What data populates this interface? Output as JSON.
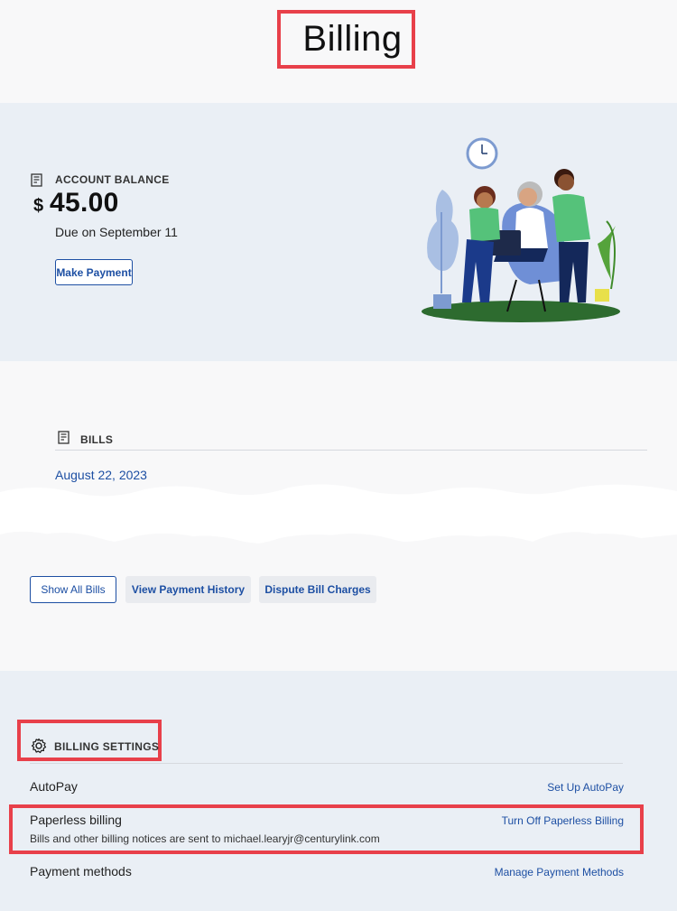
{
  "page": {
    "title": "Billing"
  },
  "balance": {
    "label": "ACCOUNT BALANCE",
    "currency": "$",
    "amount": "45.00",
    "due": "Due on September 11",
    "pay_button": "Make Payment"
  },
  "bills": {
    "label": "BILLS",
    "items": [
      "August 22, 2023"
    ],
    "buttons": {
      "show_all": "Show All Bills",
      "history": "View Payment History",
      "dispute": "Dispute Bill Charges"
    }
  },
  "settings": {
    "label": "BILLING SETTINGS",
    "autopay": {
      "label": "AutoPay",
      "link": "Set Up AutoPay"
    },
    "paperless": {
      "label": "Paperless billing",
      "link": "Turn Off Paperless Billing",
      "note": "Bills and other billing notices are sent to michael.learyjr@centurylink.com"
    },
    "payment_methods": {
      "label": "Payment methods",
      "link": "Manage Payment Methods"
    }
  },
  "colors": {
    "accent": "#1d4fa3",
    "highlight": "#e8404a",
    "panel": "#eaeff5"
  },
  "icons": {
    "account_balance": "receipt-icon",
    "bills": "receipt-icon",
    "settings": "gear-icon"
  }
}
